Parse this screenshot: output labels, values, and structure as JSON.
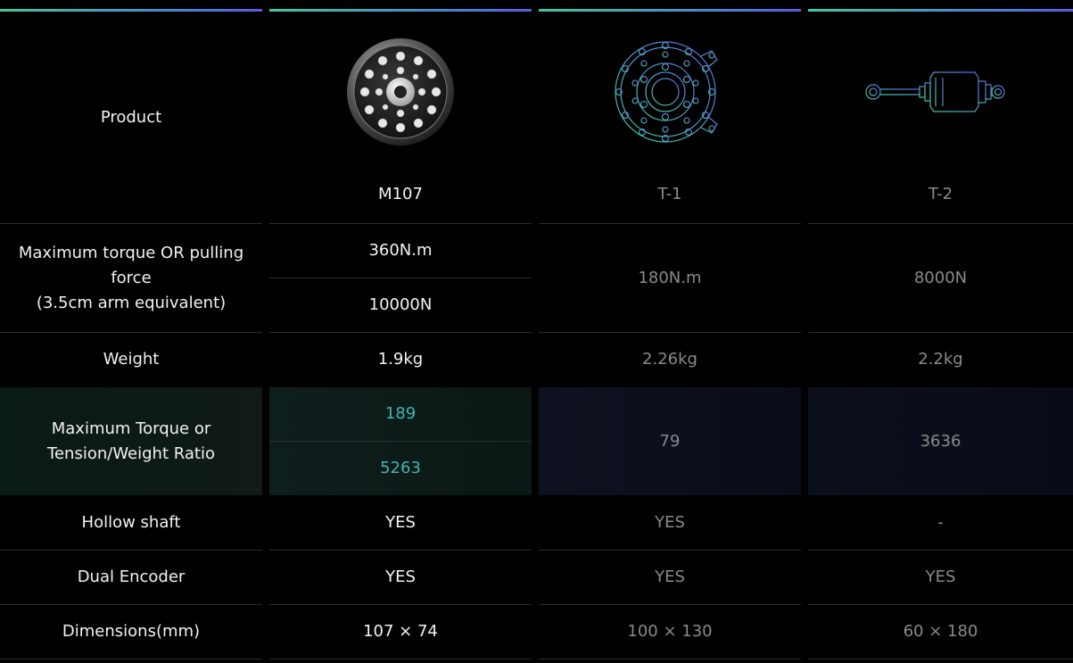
{
  "labels": {
    "product": "Product",
    "torque_line1": "Maximum torque OR pulling",
    "torque_line2": "force",
    "torque_line3": "(3.5cm arm equivalent)",
    "weight": "Weight",
    "ratio_line1": "Maximum Torque or",
    "ratio_line2": "Tension/Weight Ratio",
    "hollow": "Hollow shaft",
    "encoder": "Dual Encoder",
    "dimensions": "Dimensions(mm)"
  },
  "products": [
    {
      "name": "M107",
      "image_icon": "motor-photo-icon",
      "torque": "360N.m",
      "pulling_force": "10000N",
      "weight": "1.9kg",
      "ratio_torque": "189",
      "ratio_force": "5263",
      "hollow": "YES",
      "encoder": "YES",
      "dimensions": "107 × 74"
    },
    {
      "name": "T-1",
      "image_icon": "rotary-actuator-outline-icon",
      "torque_or_force": "180N.m",
      "weight": "2.26kg",
      "ratio": "79",
      "hollow": "YES",
      "encoder": "YES",
      "dimensions": "100 × 130"
    },
    {
      "name": "T-2",
      "image_icon": "linear-actuator-outline-icon",
      "torque_or_force": "8000N",
      "weight": "2.2kg",
      "ratio": "3636",
      "hollow": "-",
      "encoder": "YES",
      "dimensions": "60 × 180"
    }
  ],
  "colors": {
    "accent_green": "#3fc9a0",
    "accent_blue": "#5a5ae0",
    "ratio_teal": "#3fb7b0"
  }
}
